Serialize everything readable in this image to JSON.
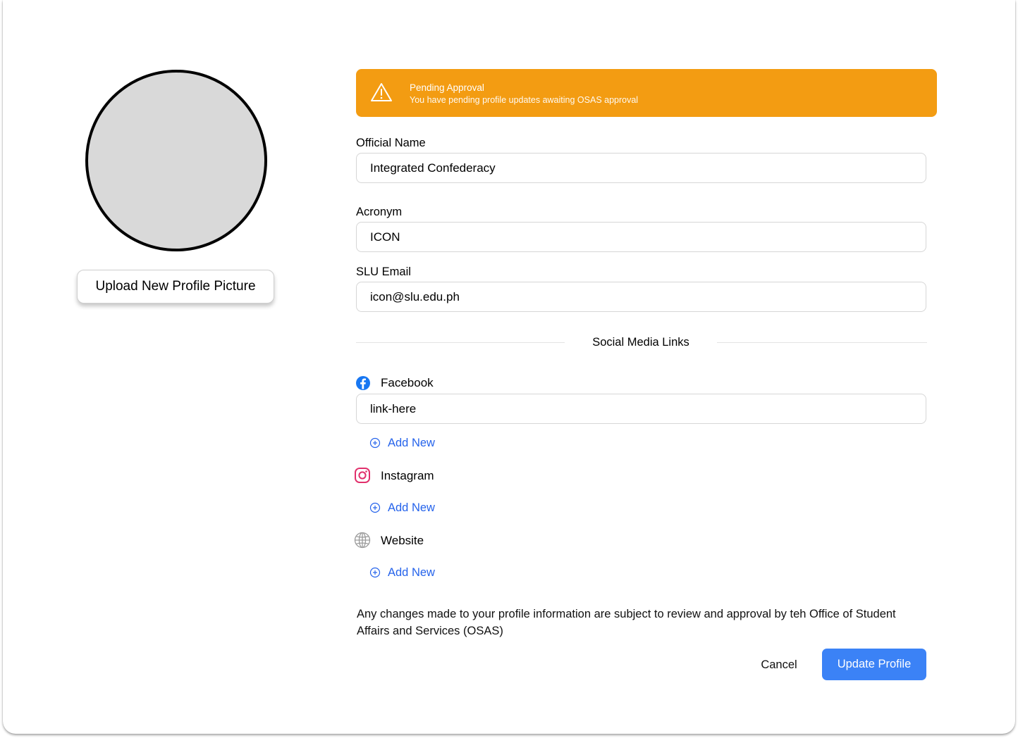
{
  "profile": {
    "upload_button_label": "Upload New Profile Picture"
  },
  "banner": {
    "title": "Pending Approval",
    "message": "You have pending profile updates awaiting OSAS approval",
    "icon": "warning-icon",
    "color": "#f39c12"
  },
  "form": {
    "official_name": {
      "label": "Official Name",
      "value": "Integrated Confederacy"
    },
    "acronym": {
      "label": "Acronym",
      "value": "ICON"
    },
    "slu_email": {
      "label": "SLU Email",
      "value": "icon@slu.edu.ph"
    }
  },
  "social": {
    "heading": "Social Media Links",
    "facebook": {
      "label": "Facebook",
      "icon": "facebook-icon",
      "value": "link-here",
      "add_label": "Add New"
    },
    "instagram": {
      "label": "Instagram",
      "icon": "instagram-icon",
      "add_label": "Add New"
    },
    "website": {
      "label": "Website",
      "icon": "globe-icon",
      "add_label": "Add New"
    }
  },
  "notice": "Any changes made to your profile information are subject to review and approval by teh Office of Student Affairs and Services (OSAS)",
  "actions": {
    "cancel_label": "Cancel",
    "update_label": "Update Profile",
    "accent_color": "#3b82f6",
    "link_color": "#2563eb"
  }
}
